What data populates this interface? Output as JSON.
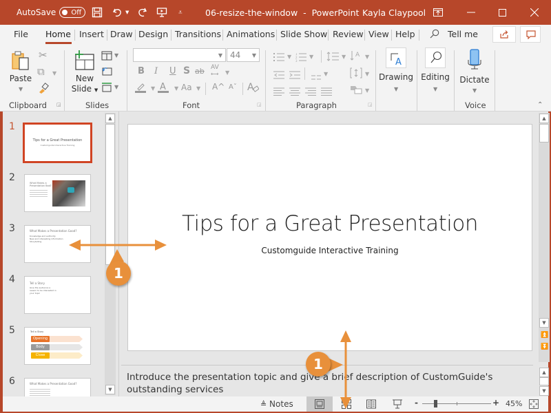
{
  "titlebar": {
    "autosave_label": "AutoSave",
    "autosave_state": "Off",
    "filename": "06-resize-the-window",
    "separator": "-",
    "app_name": "PowerPoint",
    "user_name": "Kayla Claypool",
    "icons": [
      "save-icon",
      "undo-icon",
      "redo-icon",
      "present-icon",
      "customize-qat-icon",
      "ribbon-display-icon",
      "minimize-icon",
      "maximize-icon",
      "close-icon"
    ]
  },
  "tabs": [
    {
      "label": "File"
    },
    {
      "label": "Home",
      "active": true
    },
    {
      "label": "Insert"
    },
    {
      "label": "Draw"
    },
    {
      "label": "Design"
    },
    {
      "label": "Transitions"
    },
    {
      "label": "Animations"
    },
    {
      "label": "Slide Show"
    },
    {
      "label": "Review"
    },
    {
      "label": "View"
    },
    {
      "label": "Help"
    }
  ],
  "tell_me": "Tell me",
  "ribbon": {
    "clipboard": {
      "label": "Clipboard",
      "paste": "Paste"
    },
    "slides": {
      "label": "Slides",
      "new_slide_line1": "New",
      "new_slide_line2": "Slide"
    },
    "font": {
      "label": "Font",
      "font_name": "",
      "font_size": "44",
      "bold": "B",
      "italic": "I",
      "underline": "U",
      "shadow": "S",
      "strike": "ab",
      "spacing": "AV",
      "font_color": "A",
      "change_case": "Aa",
      "grow": "A^",
      "shrink": "Aˇ"
    },
    "paragraph": {
      "label": "Paragraph"
    },
    "drawing": {
      "label": "Drawing"
    },
    "editing": {
      "label": "Editing"
    },
    "voice": {
      "label": "Voice",
      "dictate": "Dictate"
    }
  },
  "thumbnails": [
    {
      "num": "1",
      "title": "Tips for a Great Presentation",
      "subtitle": "Customguide Interactive Training",
      "selected": true
    },
    {
      "num": "2",
      "title": "What Makes a Presentation Bad?",
      "has_photo": true
    },
    {
      "num": "3",
      "title": "What Makes a Presentation Good?",
      "bullets": [
        "Knowledge and authority",
        "New and interesting information",
        "Storytelling"
      ]
    },
    {
      "num": "4",
      "title": "Tell a Story",
      "body": "Give the audience a reason to be interested in your topic"
    },
    {
      "num": "5",
      "title": "Tell a Story",
      "stages": [
        "Opening",
        "Body",
        "Close"
      ]
    },
    {
      "num": "6",
      "title": "What Makes a Presentation Good?"
    }
  ],
  "slide": {
    "title": "Tips for a Great Presentation",
    "subtitle": "Customguide Interactive Training"
  },
  "notes": {
    "text": "Introduce the presentation topic and give a brief description of CustomGuide's outstanding services"
  },
  "statusbar": {
    "notes_label": "Notes",
    "zoom_minus": "-",
    "zoom_plus": "+",
    "zoom_level": "45%",
    "zoom_percent": 45
  },
  "callouts": [
    {
      "label": "1",
      "target": "thumbnail-pane-splitter"
    },
    {
      "label": "1",
      "target": "notes-pane-splitter"
    }
  ],
  "colors": {
    "accent": "#b7472a",
    "callout": "#e8903b",
    "selected_thumb": "#d04423"
  }
}
